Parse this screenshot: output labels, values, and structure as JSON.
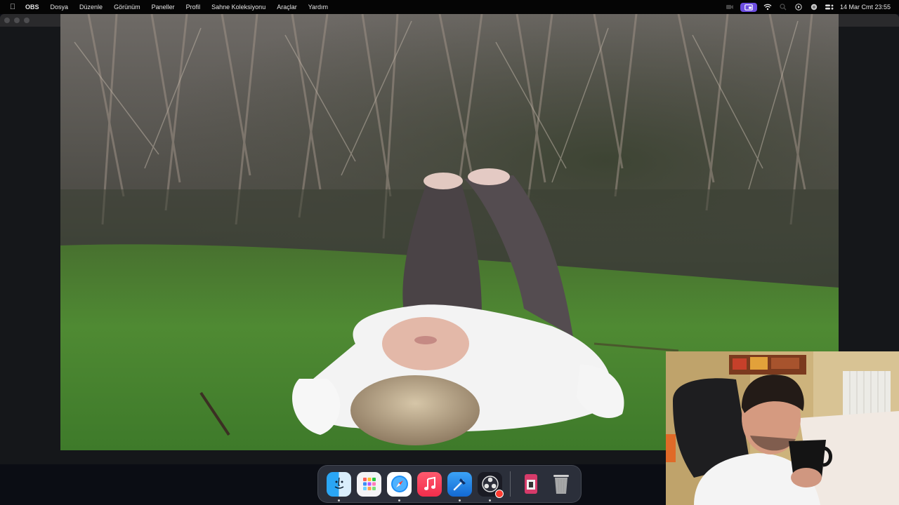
{
  "menubar": {
    "apple_icon": "apple-logo-icon",
    "app_name": "OBS",
    "menus": [
      "Dosya",
      "Düzenle",
      "Görünüm",
      "Paneller",
      "Profil",
      "Sahne Koleksiyonu",
      "Araçlar",
      "Yardım"
    ],
    "status_icons": [
      "screen-recording-icon",
      "screen-share-icon",
      "wifi-icon",
      "search-icon",
      "play-circle-icon",
      "siri-icon",
      "control-center-icon"
    ],
    "clock": "14 Mar Cmt  23:55"
  },
  "window": {
    "title": "",
    "preview_description": "scene preview"
  },
  "dock": {
    "apps": [
      {
        "name": "Finder",
        "icon": "finder-icon",
        "running": true
      },
      {
        "name": "Launchpad",
        "icon": "launchpad-icon",
        "running": false
      },
      {
        "name": "Safari",
        "icon": "safari-icon",
        "running": true
      },
      {
        "name": "Music",
        "icon": "music-icon",
        "running": false
      },
      {
        "name": "Xcode",
        "icon": "xcode-icon",
        "running": true
      },
      {
        "name": "OBS",
        "icon": "obs-icon",
        "running": true
      }
    ],
    "others": [
      {
        "name": "Downloads",
        "icon": "downloads-stack-icon"
      },
      {
        "name": "Trash",
        "icon": "trash-icon"
      }
    ]
  },
  "colors": {
    "menubar_bg": "#050505",
    "screen_share_accent": "#6c4de0",
    "window_bg": "#1c1c1e"
  }
}
